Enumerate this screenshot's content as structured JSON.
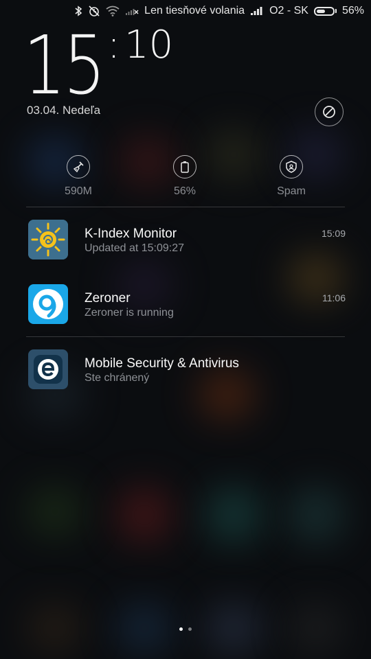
{
  "status_bar": {
    "carrier_notice": "Len tiesňové volania",
    "operator": "O2 - SK",
    "battery_percent": "56%",
    "battery_level": 0.56,
    "icons": [
      "bluetooth-icon",
      "alarm-off-icon",
      "wifi-icon",
      "no-signal-icon",
      "signal-icon",
      "battery-icon"
    ]
  },
  "lockscreen": {
    "hours": "15",
    "minutes": "10",
    "date": "03.04. Nedeľa"
  },
  "quick_stats": [
    {
      "icon": "broom-clean-icon",
      "label": "590M"
    },
    {
      "icon": "battery-icon",
      "label": "56%"
    },
    {
      "icon": "shield-icon",
      "label": "Spam"
    }
  ],
  "notifications": [
    {
      "app": "K-Index Monitor",
      "text": "Updated at 15:09:27",
      "time": "15:09",
      "icon": "sun-icon"
    },
    {
      "app": "Zeroner",
      "text": "Zeroner is running",
      "time": "11:06",
      "icon": "zeroner-logo-icon"
    },
    {
      "app": "Mobile Security & Antivirus",
      "text": "Ste chránený",
      "time": "",
      "icon": "eset-logo-icon"
    }
  ],
  "pager": {
    "pages": 2,
    "current": 1
  },
  "colors": {
    "background": "#0b0d10",
    "accent_blue": "#1aa7e8",
    "kindex_bg": "#3a6e8f",
    "eset_bg": "#2d4f6a"
  }
}
